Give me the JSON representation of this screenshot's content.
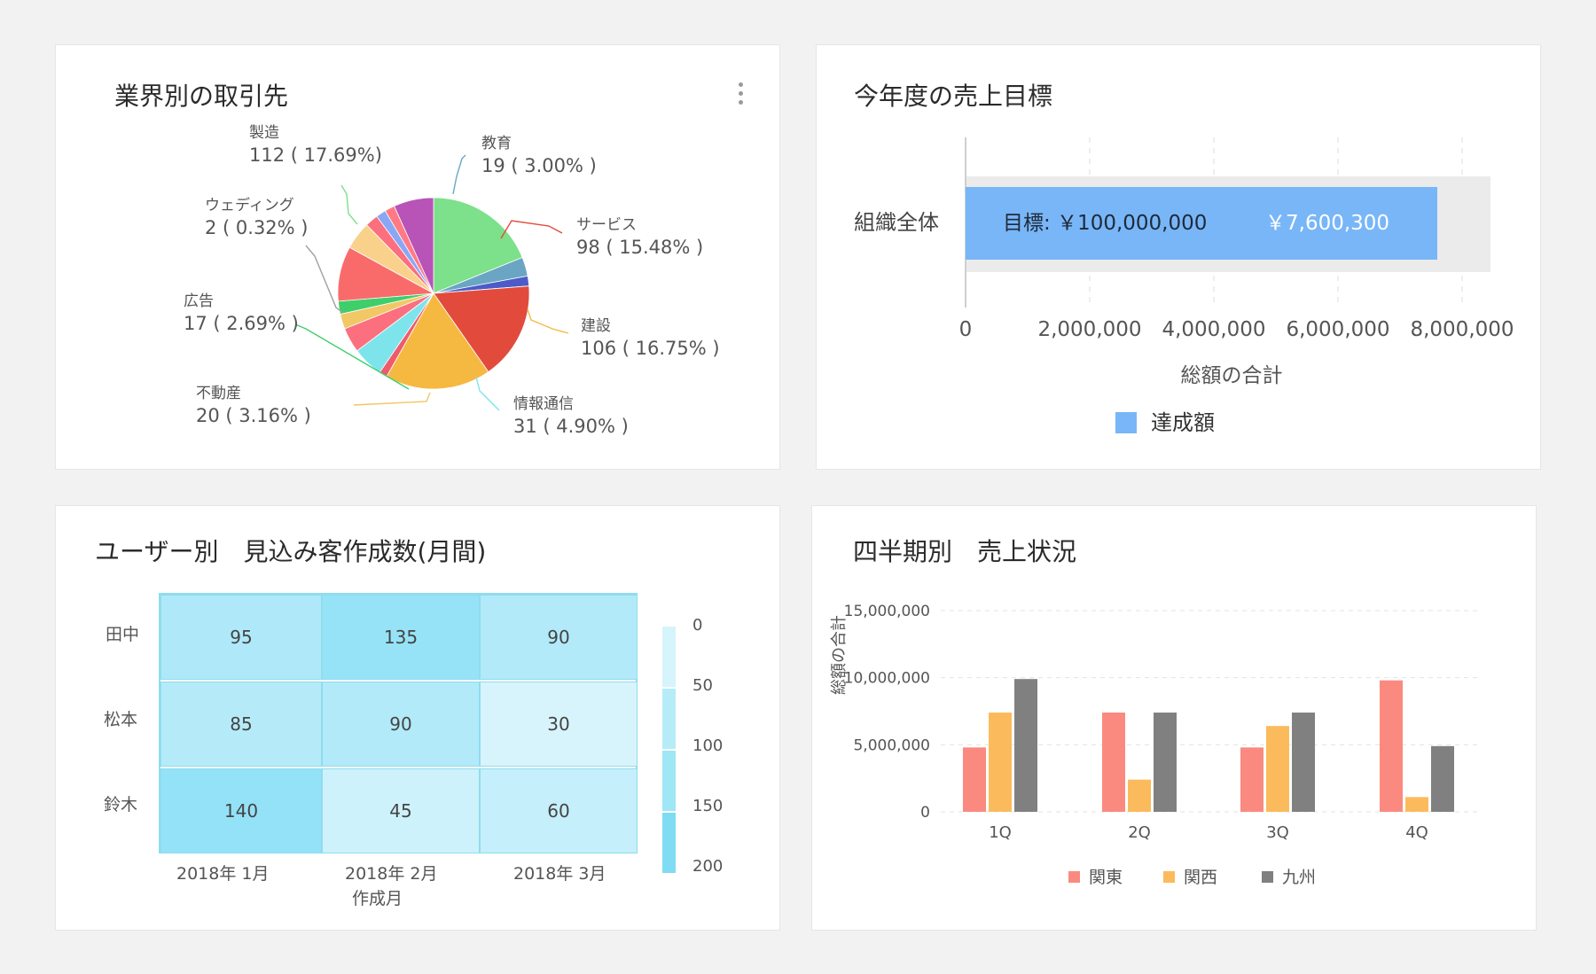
{
  "pie_card": {
    "title": "業界別の取引先",
    "labels": [
      {
        "name": "製造",
        "value": "112 ( 17.69%)"
      },
      {
        "name": "教育",
        "value": "19 ( 3.00% )"
      },
      {
        "name": "サービス",
        "value": "98 ( 15.48% )"
      },
      {
        "name": "建設",
        "value": "106 ( 16.75% )"
      },
      {
        "name": "情報通信",
        "value": "31 ( 4.90% )"
      },
      {
        "name": "不動産",
        "value": "20 ( 3.16% )"
      },
      {
        "name": "広告",
        "value": "17 ( 2.69% )"
      },
      {
        "name": "ウェディング",
        "value": "2 ( 0.32% )"
      }
    ]
  },
  "goal_card": {
    "title": "今年度の売上目標",
    "category": "組織全体",
    "goal_text": "目標: ￥100,000,000",
    "achieved_text": "￥7,600,300",
    "xlabel": "総額の合計",
    "legend": "達成額",
    "ticks": [
      "0",
      "2,000,000",
      "4,000,000",
      "6,000,000",
      "8,000,000"
    ]
  },
  "heatmap_card": {
    "title": "ユーザー別　見込み客作成数(月間)",
    "rows": [
      "田中",
      "松本",
      "鈴木"
    ],
    "cols": [
      "2018年 1月",
      "2018年 2月",
      "2018年 3月"
    ],
    "xlabel": "作成月",
    "scale": [
      "0",
      "50",
      "100",
      "150",
      "200"
    ]
  },
  "quarter_card": {
    "title": "四半期別　売上状況",
    "ylabel": "総額の合計",
    "yticks": [
      "15,000,000",
      "10,000,000",
      "5,000,000",
      "0"
    ],
    "categories": [
      "1Q",
      "2Q",
      "3Q",
      "4Q"
    ],
    "legend": [
      "関東",
      "関西",
      "九州"
    ]
  },
  "chart_data": [
    {
      "type": "pie",
      "title": "業界別の取引先",
      "slices": [
        {
          "label": "製造",
          "value": 112,
          "color": "#7de08a"
        },
        {
          "label": "教育",
          "value": 19,
          "color": "#6aa6c4"
        },
        {
          "label": "",
          "value": 10,
          "color": "#4c5bc7"
        },
        {
          "label": "サービス",
          "value": 98,
          "color": "#e24b3c"
        },
        {
          "label": "建設",
          "value": 106,
          "color": "#f5b942"
        },
        {
          "label": "",
          "value": 8,
          "color": "#ee5c6b"
        },
        {
          "label": "情報通信",
          "value": 31,
          "color": "#7ee4ec"
        },
        {
          "label": "",
          "value": 25,
          "color": "#fb6f7e"
        },
        {
          "label": "",
          "value": 15,
          "color": "#f2c765"
        },
        {
          "label": "",
          "value": 13,
          "color": "#3ecf6a"
        },
        {
          "label": "",
          "value": 55,
          "color": "#f96b6b"
        },
        {
          "label": "",
          "value": 28,
          "color": "#f9d18b"
        },
        {
          "label": "",
          "value": 13,
          "color": "#fb6f7e"
        },
        {
          "label": "",
          "value": 10,
          "color": "#8aa7f5"
        },
        {
          "label": "",
          "value": 10,
          "color": "#ff7a85"
        },
        {
          "label": "",
          "value": 40,
          "color": "#b853b8"
        }
      ]
    },
    {
      "type": "bar",
      "title": "今年度の売上目標",
      "orientation": "horizontal",
      "categories": [
        "組織全体"
      ],
      "series": [
        {
          "name": "達成額",
          "values": [
            7600300
          ],
          "color": "#78b6f7"
        }
      ],
      "goal": 100000000,
      "xlim": [
        0,
        8400000
      ],
      "xlabel": "総額の合計"
    },
    {
      "type": "heatmap",
      "title": "ユーザー別　見込み客作成数(月間)",
      "rows": [
        "田中",
        "松本",
        "鈴木"
      ],
      "cols": [
        "2018年 1月",
        "2018年 2月",
        "2018年 3月"
      ],
      "values": [
        [
          95,
          135,
          90
        ],
        [
          85,
          90,
          30
        ],
        [
          140,
          45,
          60
        ]
      ],
      "range": [
        0,
        200
      ],
      "xlabel": "作成月"
    },
    {
      "type": "bar",
      "title": "四半期別　売上状況",
      "categories": [
        "1Q",
        "2Q",
        "3Q",
        "4Q"
      ],
      "series": [
        {
          "name": "関東",
          "values": [
            4800000,
            7400000,
            4800000,
            9800000
          ],
          "color": "#fa8a80"
        },
        {
          "name": "関西",
          "values": [
            7400000,
            2400000,
            6400000,
            1100000
          ],
          "color": "#fbbb5c"
        },
        {
          "name": "九州",
          "values": [
            9900000,
            7400000,
            7400000,
            4900000
          ],
          "color": "#808080"
        }
      ],
      "ylim": [
        0,
        15000000
      ],
      "ylabel": "総額の合計"
    }
  ]
}
